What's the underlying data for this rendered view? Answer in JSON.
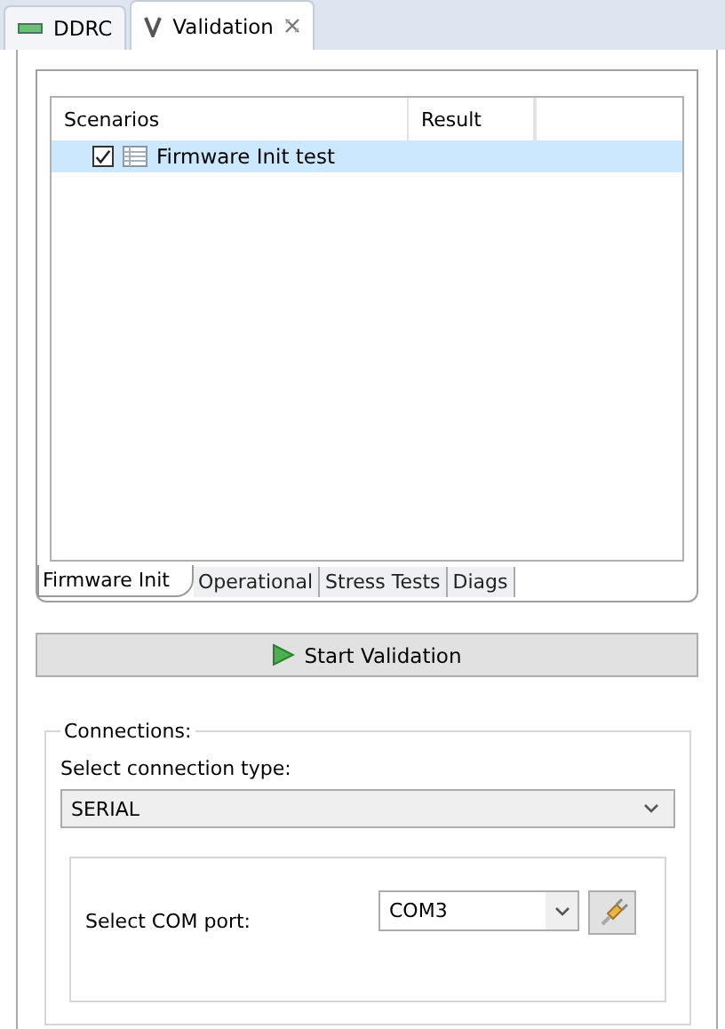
{
  "editor_tabs": [
    {
      "label": "DDRC",
      "kind": "bar",
      "selected": false
    },
    {
      "label": "Validation",
      "kind": "v",
      "selected": true
    }
  ],
  "scenarios_table": {
    "columns": [
      "Scenarios",
      "Result"
    ],
    "rows": [
      {
        "name": "Firmware Init test",
        "checked": true,
        "selected": true
      }
    ]
  },
  "suite_tabs": [
    {
      "label": "Firmware Init",
      "selected": true
    },
    {
      "label": "Operational",
      "selected": false
    },
    {
      "label": "Stress Tests",
      "selected": false
    },
    {
      "label": "Diags",
      "selected": false
    }
  ],
  "start_button": {
    "label": "Start Validation"
  },
  "connections": {
    "title": "Connections:",
    "type_label": "Select connection type:",
    "type_value": "SERIAL",
    "port_label": "Select COM port:",
    "port_value": "COM3"
  }
}
